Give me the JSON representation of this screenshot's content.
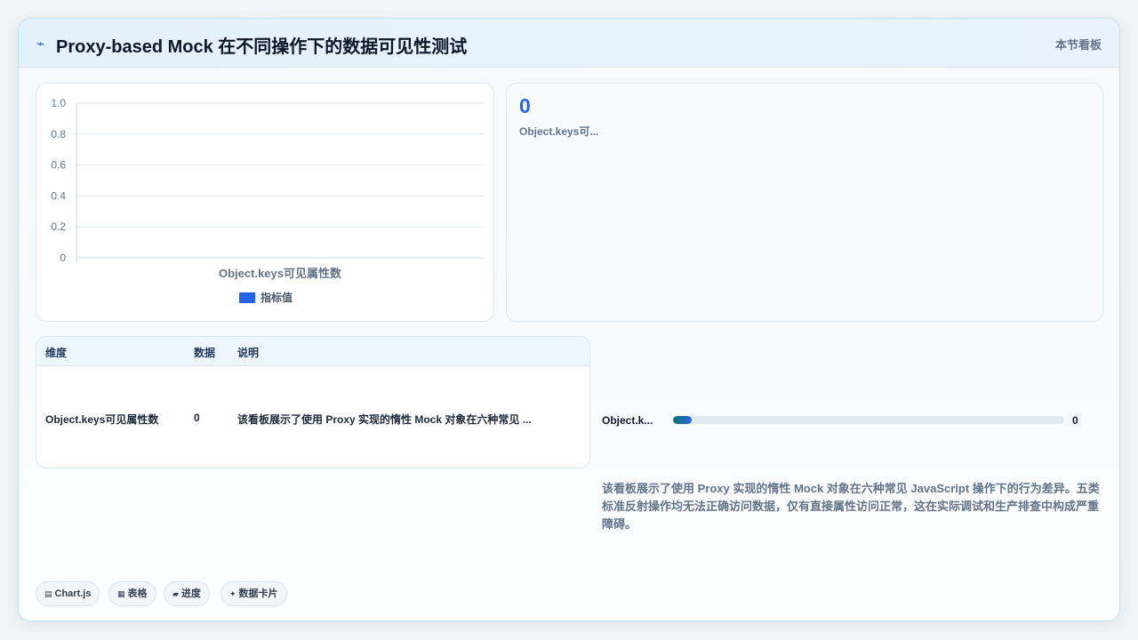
{
  "header": {
    "icon": "pulse-icon",
    "title": "Proxy-based Mock 在不同操作下的数据可见性测试",
    "action_label": "本节看板"
  },
  "chart_data": {
    "type": "bar",
    "categories": [
      "Object.keys可见属性数"
    ],
    "series": [
      {
        "name": "指标值",
        "values": [
          0
        ],
        "color": "#2563eb"
      }
    ],
    "ylim": [
      0,
      1
    ],
    "yticks": [
      "1.0",
      "0.8",
      "0.6",
      "0.4",
      "0.2",
      "0"
    ],
    "grid": true,
    "legend_position": "bottom"
  },
  "stat_card": {
    "value": "0",
    "label": "Object.keys可..."
  },
  "table": {
    "headers": [
      "维度",
      "数据",
      "说明"
    ],
    "rows": [
      [
        "Object.keys可见属性数",
        "0",
        "该看板展示了使用 Proxy 实现的惰性 Mock 对象在六种常见 ..."
      ]
    ]
  },
  "progress": {
    "label": "Object.k...",
    "value": 0,
    "value_text": "0"
  },
  "description": "该看板展示了使用 Proxy 实现的惰性 Mock 对象在六种常见 JavaScript 操作下的行为差异。五类标准反射操作均无法正确访问数据，仅有直接属性访问正常，这在实际调试和生产排查中构成严重障碍。",
  "tags": [
    {
      "icon": "chart-icon",
      "glyph": "▤",
      "label": "Chart.js"
    },
    {
      "icon": "table-icon",
      "glyph": "▦",
      "label": "表格"
    },
    {
      "icon": "progress-icon",
      "glyph": "▰",
      "label": "进度"
    },
    {
      "icon": "spark-icon",
      "glyph": "✦",
      "label": "数据卡片"
    }
  ]
}
